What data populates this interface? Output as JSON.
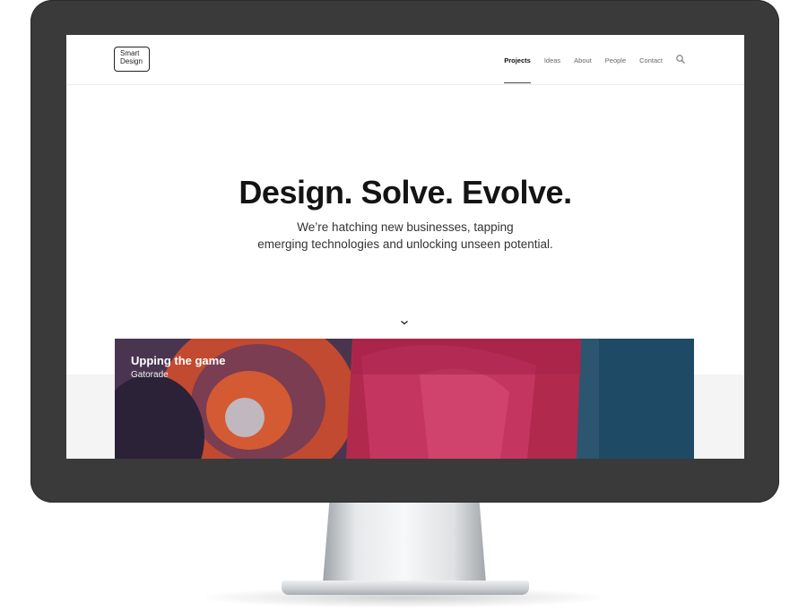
{
  "logo": {
    "line1": "Smart",
    "line2": "Design"
  },
  "nav": {
    "items": [
      {
        "label": "Projects",
        "active": true
      },
      {
        "label": "Ideas",
        "active": false
      },
      {
        "label": "About",
        "active": false
      },
      {
        "label": "People",
        "active": false
      },
      {
        "label": "Contact",
        "active": false
      }
    ],
    "search_icon": "search-icon"
  },
  "hero": {
    "title": "Design. Solve. Evolve.",
    "subtitle_line1": "We’re hatching new businesses, tapping",
    "subtitle_line2": "emerging technologies and unlocking unseen potential."
  },
  "scroll_icon": "chevron-down-icon",
  "project": {
    "title": "Upping the game",
    "client": "Gatorade"
  },
  "colors": {
    "bezel": "#3a3a3a",
    "text_primary": "#141414",
    "nav_muted": "#666666"
  }
}
